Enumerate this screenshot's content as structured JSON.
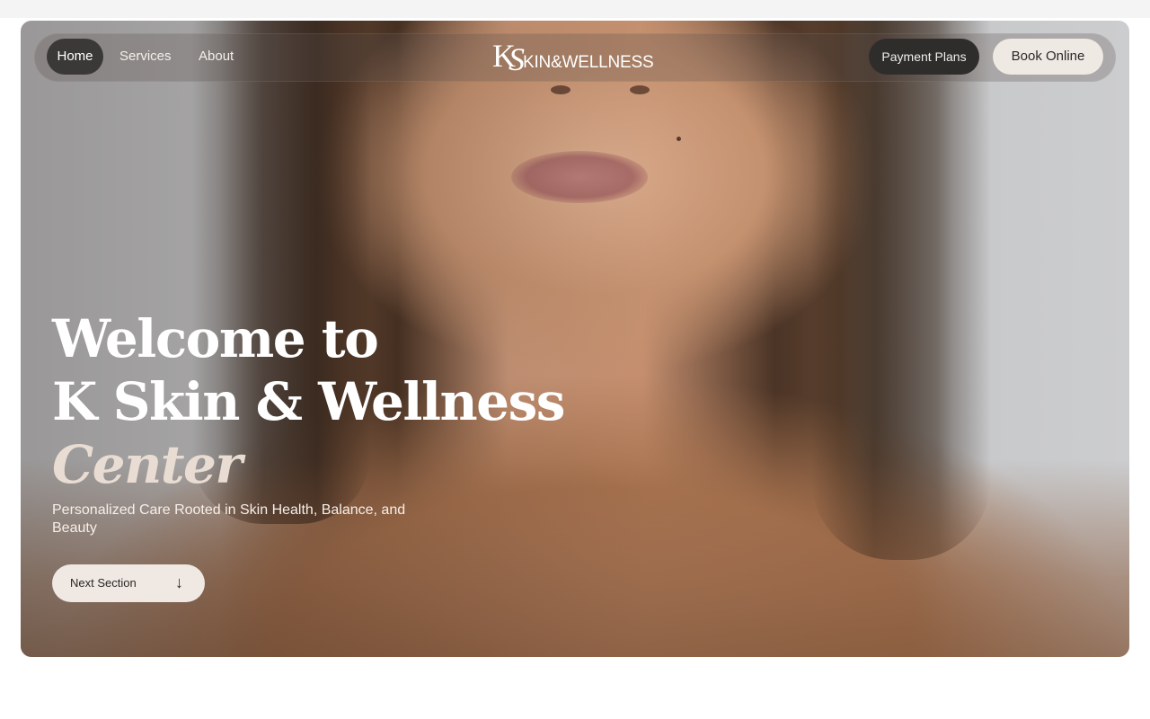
{
  "nav": {
    "links": [
      {
        "label": "Home",
        "active": true
      },
      {
        "label": "Services",
        "active": false
      },
      {
        "label": "About",
        "active": false
      }
    ],
    "logo": {
      "mark_k": "K",
      "mark_s": "S",
      "text": "KIN&WELLNESS"
    },
    "payment_label": "Payment Plans",
    "book_label": "Book Online"
  },
  "hero": {
    "headline_line1": "Welcome to",
    "headline_line2": "K Skin & Wellness",
    "headline_accent": "Center",
    "subtitle": "Personalized Care Rooted in Skin Health, Balance, and Beauty",
    "next_label": "Next Section",
    "next_icon": "arrow-down-icon"
  },
  "colors": {
    "accent_cream": "#efe8e3",
    "dark_button": "#2e2d2c",
    "accent_text": "#e9ddd3"
  }
}
